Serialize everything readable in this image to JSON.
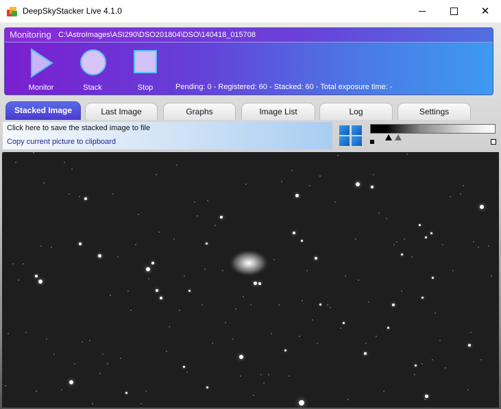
{
  "window": {
    "title": "DeepSkyStacker Live 4.1.0"
  },
  "monitoring": {
    "title": "Monitoring",
    "path": "C:\\AstroImages\\ASI290\\DSO201804\\DSO\\140418_015708",
    "controls": [
      {
        "label": "Monitor",
        "icon": "play-icon"
      },
      {
        "label": "Stack",
        "icon": "circle-icon"
      },
      {
        "label": "Stop",
        "icon": "square-icon"
      }
    ],
    "status": "Pending: 0 - Registered: 60 - Stacked: 60 - Total exposure time: -"
  },
  "tabs": [
    "Stacked Image",
    "Last Image",
    "Graphs",
    "Image List",
    "Log",
    "Settings"
  ],
  "actions": {
    "save": "Click here to save the stacked image to file",
    "copy": "Copy current picture to clipboard"
  },
  "colors": {
    "accent_left": "#7a1fd0",
    "accent_right": "#3d9af0",
    "image_bg": "#1e1e1e"
  }
}
